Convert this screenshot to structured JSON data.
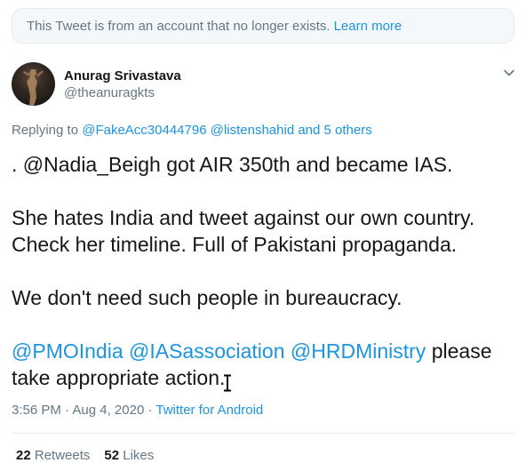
{
  "notice": {
    "text": "This Tweet is from an account that no longer exists.",
    "link": "Learn more"
  },
  "author": {
    "name": "Anurag Srivastava",
    "handle": "@theanuragkts"
  },
  "replying": {
    "prefix": "Replying to",
    "mention1": "@FakeAcc30444796",
    "mention2": "@listenshahid",
    "others": "and 5 others"
  },
  "tweet": {
    "line1": ". @Nadia_Beigh got AIR 350th and became IAS.",
    "line2": "She hates India and tweet against our own country. Check her timeline. Full of Pakistani propaganda.",
    "line3": "We don't need such people in bureaucracy.",
    "mention_pmo": "@PMOIndia",
    "mention_ias": "@IASassociation",
    "mention_hrd": "@HRDMinistry",
    "closing": "please take appropriate action."
  },
  "meta": {
    "time": "3:56 PM",
    "separator": "·",
    "date": "Aug 4, 2020",
    "source": "Twitter for Android"
  },
  "stats": {
    "retweets_count": "22",
    "retweets_label": "Retweets",
    "likes_count": "52",
    "likes_label": "Likes"
  },
  "colors": {
    "link": "#1b95e0",
    "muted": "#657786",
    "text": "#14171a"
  }
}
